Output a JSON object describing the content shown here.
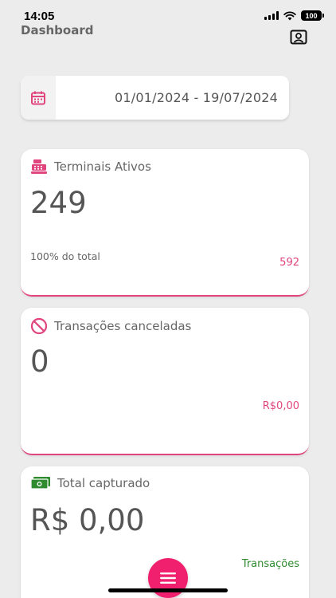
{
  "status": {
    "time": "14:05",
    "battery": "100"
  },
  "header": {
    "title": "Dashboard"
  },
  "date_filter": {
    "range": "01/01/2024 - 19/07/2024"
  },
  "cards": [
    {
      "title": "Terminais Ativos",
      "value": "249",
      "subtitle": "100% do total",
      "right": "592",
      "icon": "cash-register-icon"
    },
    {
      "title": "Transações canceladas",
      "value": "0",
      "subtitle": "",
      "right": "R$0,00",
      "icon": "prohibited-icon"
    },
    {
      "title": "Total capturado",
      "value": "R$ 0,00",
      "subtitle": "",
      "right": "Transações",
      "icon": "banknote-icon"
    }
  ],
  "colors": {
    "accent": "#e0457d",
    "fab": "#f0206e",
    "green": "#2e8b2e",
    "background": "#ececec"
  }
}
